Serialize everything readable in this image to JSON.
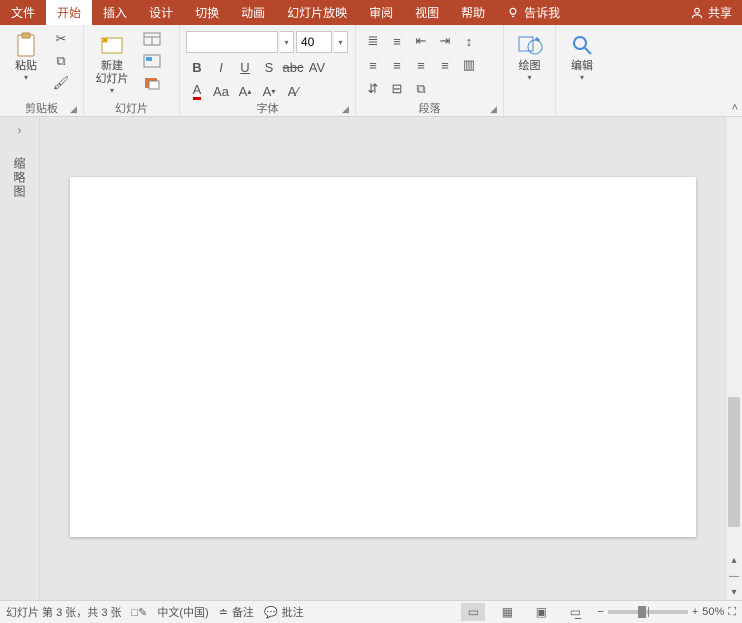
{
  "menu": {
    "file": "文件",
    "home": "开始",
    "insert": "插入",
    "design": "设计",
    "transitions": "切换",
    "animations": "动画",
    "slideshow": "幻灯片放映",
    "review": "审阅",
    "view": "视图",
    "help": "帮助",
    "tellme": "告诉我",
    "share": "共享"
  },
  "ribbon": {
    "clipboard": {
      "label": "剪贴板",
      "paste": "粘贴"
    },
    "slides": {
      "label": "幻灯片",
      "newslide": "新建\n幻灯片"
    },
    "font": {
      "label": "字体",
      "fontname": "",
      "fontsize": "40"
    },
    "paragraph": {
      "label": "段落"
    },
    "drawing": {
      "label": "绘图"
    },
    "editing": {
      "label": "编辑"
    }
  },
  "outline": {
    "label": "缩略图"
  },
  "status": {
    "slideinfo": "幻灯片 第 3 张，共 3 张",
    "language": "中文(中国)",
    "notes": "备注",
    "comments": "批注",
    "zoom": "50%"
  }
}
